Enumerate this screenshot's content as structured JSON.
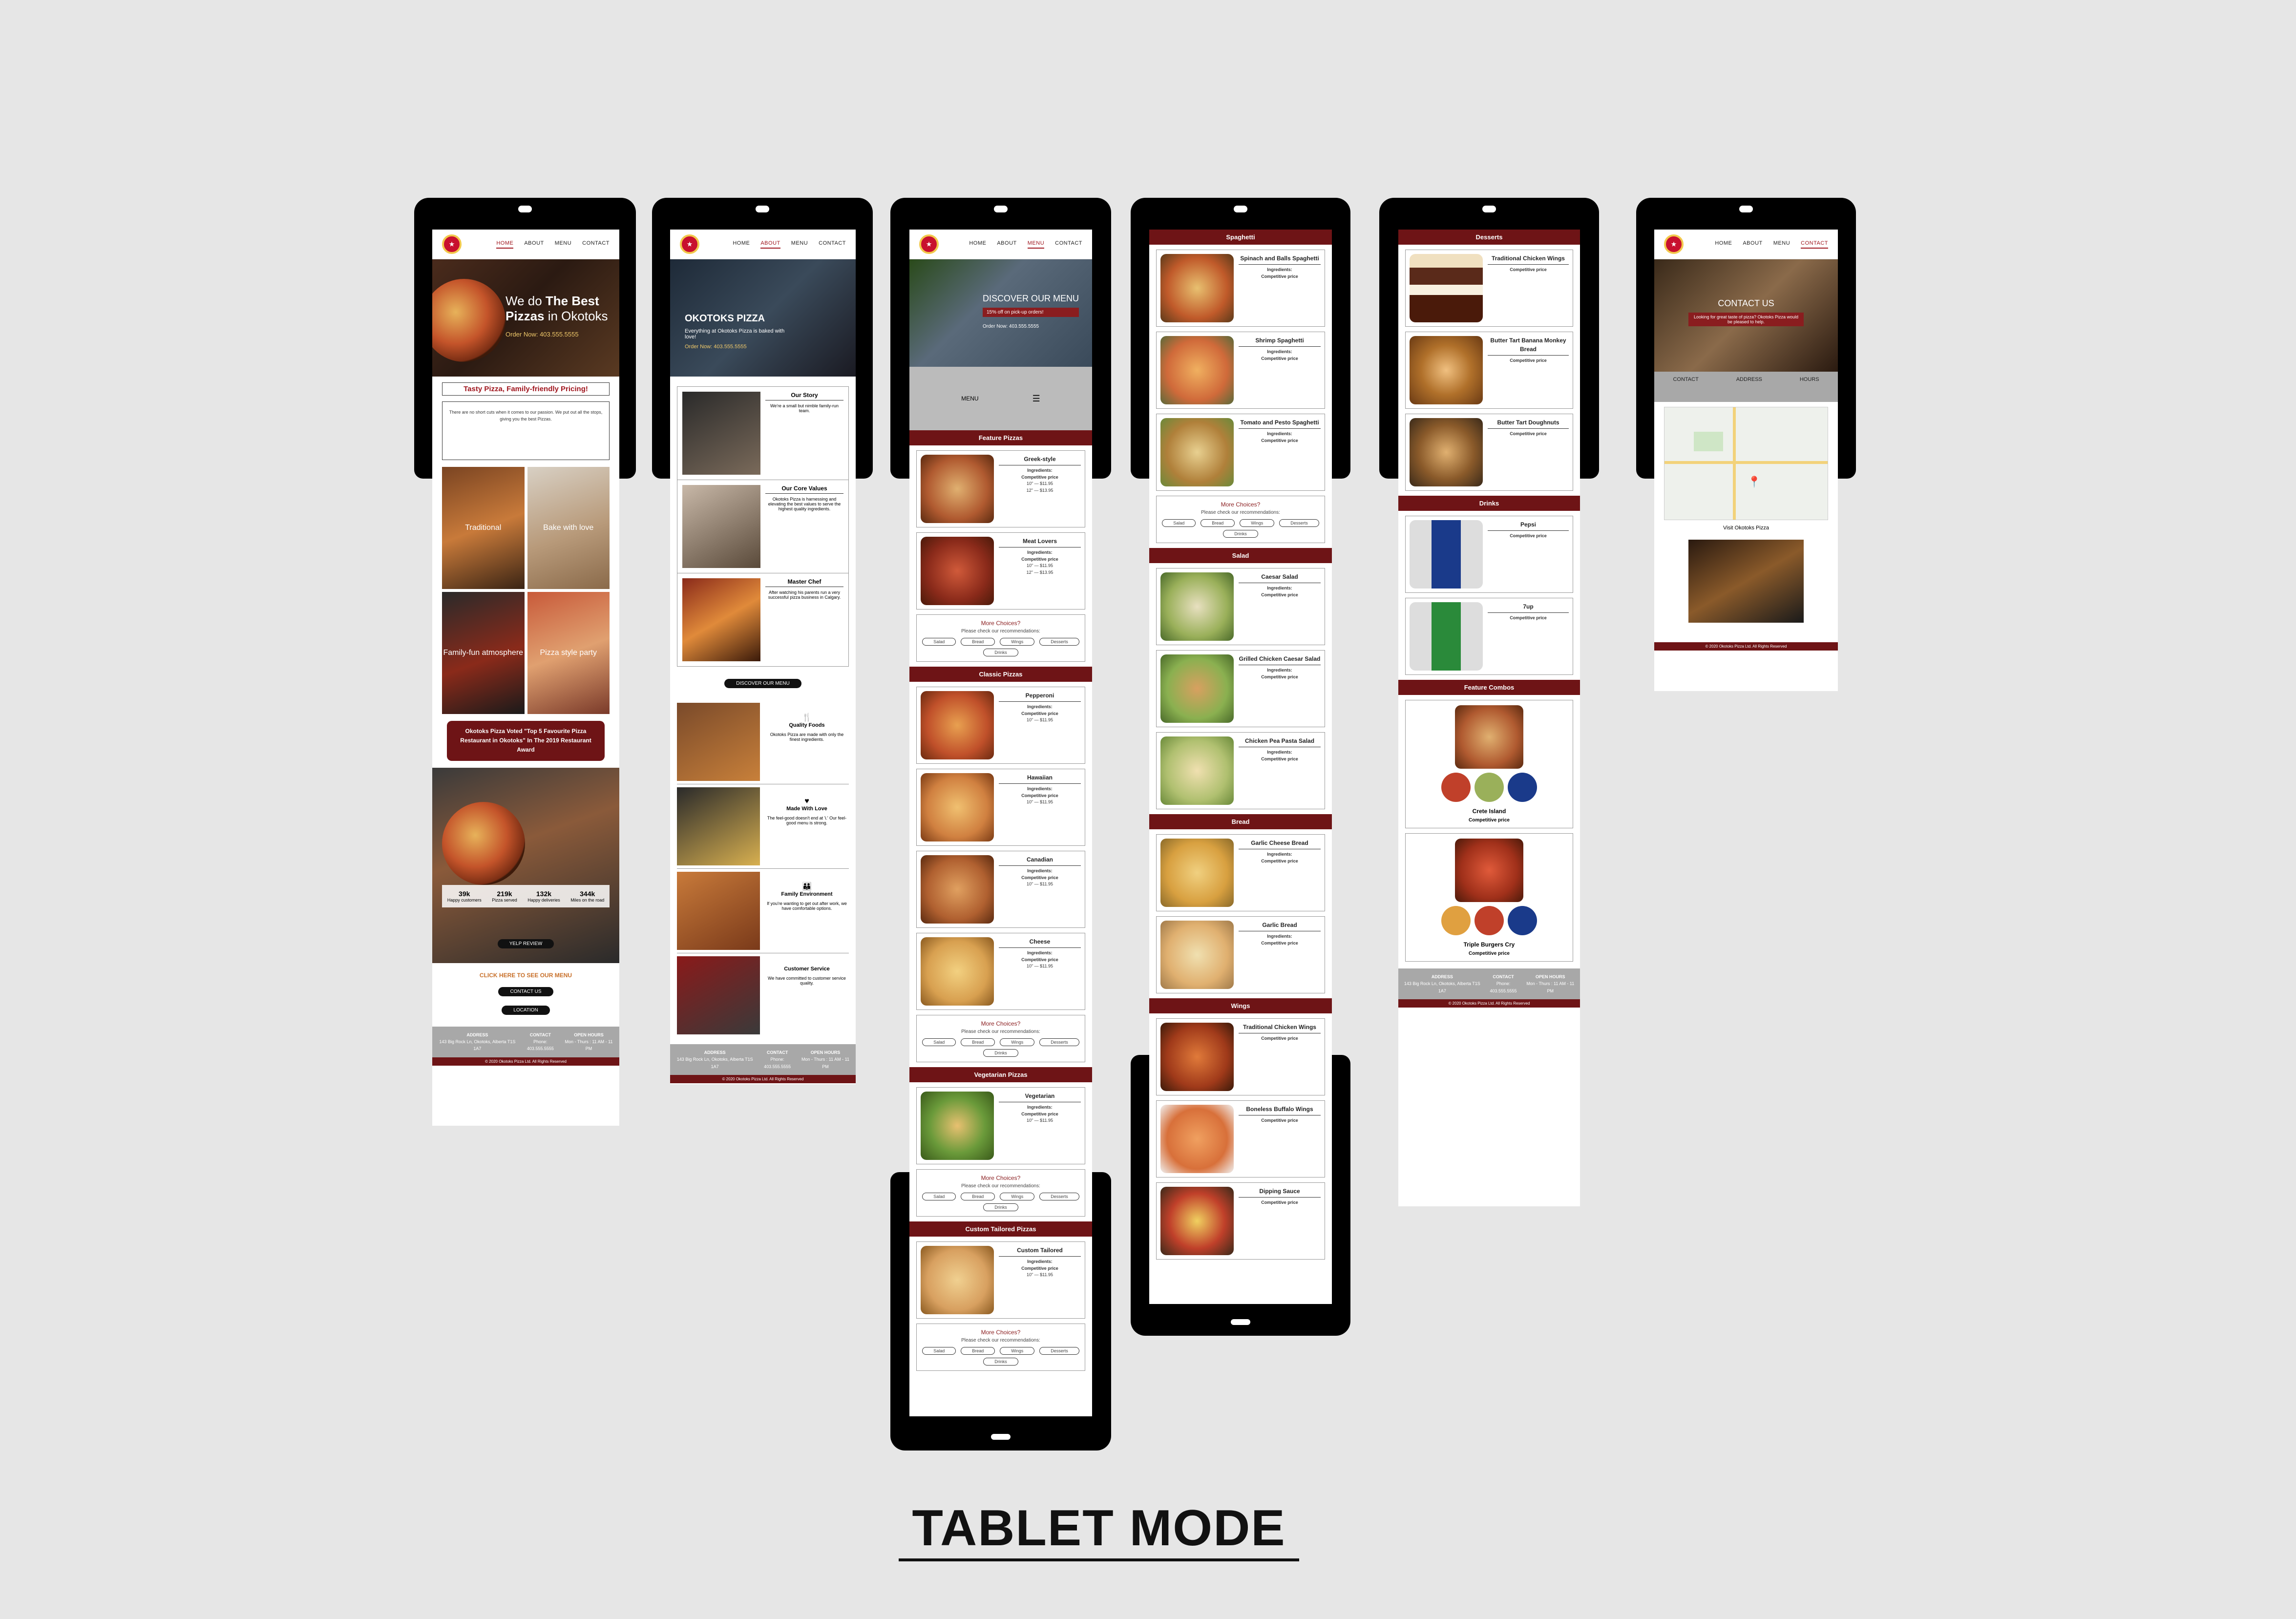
{
  "caption": "TABLET MODE",
  "nav": {
    "home": "HOME",
    "about": "ABOUT",
    "menu": "MENU",
    "contact": "CONTACT",
    "logo_text": "OKOTOKS"
  },
  "home": {
    "hero_line1": "We do ",
    "hero_bold1": "The Best",
    "hero_bold2": "Pizzas",
    "hero_line2": " in Okotoks",
    "order": "Order Now: 403.555.5555",
    "tagline": "Tasty Pizza, Family-friendly Pricing!",
    "intro": "There are no short cuts when it comes to our passion. We put out all the stops, giving you the best Pizzas.",
    "tiles": [
      "Traditional",
      "Bake with love",
      "Family-fun atmosphere",
      "Pizza style party"
    ],
    "award": "Okotoks Pizza Voted \"Top 5 Favourite Pizza Restaurant in Okotoks\" In The 2019 Restaurant Award",
    "stats": [
      {
        "num": "39k",
        "label": "Happy customers"
      },
      {
        "num": "219k",
        "label": "Pizza served"
      },
      {
        "num": "132k",
        "label": "Happy deliveries"
      },
      {
        "num": "344k",
        "label": "Miles on the road"
      }
    ],
    "yelp": "YELP REVIEW",
    "see_menu": "CLICK HERE TO SEE OUR MENU",
    "contact_btn": "CONTACT US",
    "location_btn": "LOCATION"
  },
  "footer": {
    "address_h": "ADDRESS",
    "address": "143 Big Rock Ln, Okotoks, Alberta T1S 1A7",
    "contact_h": "CONTACT",
    "contact": "Phone: 403.555.5555",
    "hours_h": "OPEN HOURS",
    "hours": "Mon - Thurs : 11 AM - 11 PM",
    "copyright": "© 2020 Okotoks Pizza Ltd. All Rights Reserved"
  },
  "about": {
    "hero_title": "OKOTOKS PIZZA",
    "hero_sub": "Everything at Okotoks Pizza is baked with love!",
    "order": "Order Now: 403.555.5555",
    "blocks": [
      {
        "title": "Our Story",
        "text": "We're a small but nimble family-run team."
      },
      {
        "title": "Our Core Values",
        "text": "Okotoks Pizza is harnessing and elevating the best values to serve the highest quality ingredients."
      },
      {
        "title": "Master Chef",
        "text": "After watching his parents run a very successful pizza business in Calgary."
      }
    ],
    "discover_btn": "DISCOVER OUR MENU",
    "features": [
      {
        "title": "Quality Foods",
        "text": "Okotoks Pizza are made with only the finest ingredients."
      },
      {
        "title": "Made With Love",
        "text": "The feel-good doesn't end at 'i.' Our feel-good menu is strong."
      },
      {
        "title": "Family Environment",
        "text": "If you're wanting to get out after work, we have comfortable options."
      },
      {
        "title": "Customer Service",
        "text": "We have committed to customer service quality."
      }
    ]
  },
  "menu1": {
    "hero_title": "DISCOVER OUR MENU",
    "hero_badge": "15% off on pick-up orders!",
    "order": "Order Now: 403.555.5555",
    "menu_label": "MENU",
    "sections": [
      "Feature Pizzas",
      "Classic Pizzas",
      "Vegetarian Pizzas",
      "Custom Tailored Pizzas"
    ],
    "pizzas_feature": [
      "Greek-style",
      "Meat Lovers"
    ],
    "pizzas_classic": [
      "Pepperoni",
      "Hawaiian",
      "Canadian",
      "Cheese"
    ],
    "pizzas_veg": [
      "Vegetarian"
    ],
    "pizzas_custom": [
      "Custom Tailored"
    ],
    "ingredients": "Ingredients:",
    "price": "Competitive price",
    "sizes": [
      "10\" — $11.95",
      "12\" — $13.95",
      "14\" — $15.95"
    ],
    "more_title": "More Choices?",
    "more_text": "Please check our recommendations:",
    "pills": [
      "Salad",
      "Bread",
      "Wings",
      "Desserts",
      "Drinks"
    ]
  },
  "menu2": {
    "sections": [
      "Spaghetti",
      "Salad",
      "Bread",
      "Wings"
    ],
    "spaghetti": [
      "Spinach and Balls Spaghetti",
      "Shrimp Spaghetti",
      "Tomato and Pesto Spaghetti"
    ],
    "salad": [
      "Caesar Salad",
      "Grilled Chicken Caesar Salad",
      "Chicken Pea Pasta Salad"
    ],
    "bread": [
      "Garlic Cheese Bread",
      "Garlic Bread"
    ],
    "wings": [
      "Traditional Chicken Wings",
      "Boneless Buffalo Wings",
      "Dipping Sauce"
    ],
    "pills": [
      "Salad",
      "Bread",
      "Wings",
      "Desserts",
      "Drinks"
    ]
  },
  "menu3": {
    "sections": [
      "Desserts",
      "Drinks",
      "Feature Combos"
    ],
    "desserts": [
      "Traditional Chicken Wings",
      "Butter Tart Banana Monkey Bread",
      "Butter Tart Doughnuts"
    ],
    "drinks": [
      "Pepsi",
      "7up"
    ],
    "combos": [
      "Crete Island",
      "Triple Burgers Cry"
    ]
  },
  "contact": {
    "hero_title": "CONTACT US",
    "hero_sub": "Looking for great taste of pizza? Okotoks Pizza would be pleased to help.",
    "tabs": [
      "CONTACT",
      "ADDRESS",
      "HOURS"
    ],
    "map_link": "Visit Okotoks Pizza"
  },
  "colors": {
    "brand": "#6e1416",
    "accent": "#f0c96a",
    "background": "#e6e6e6"
  }
}
